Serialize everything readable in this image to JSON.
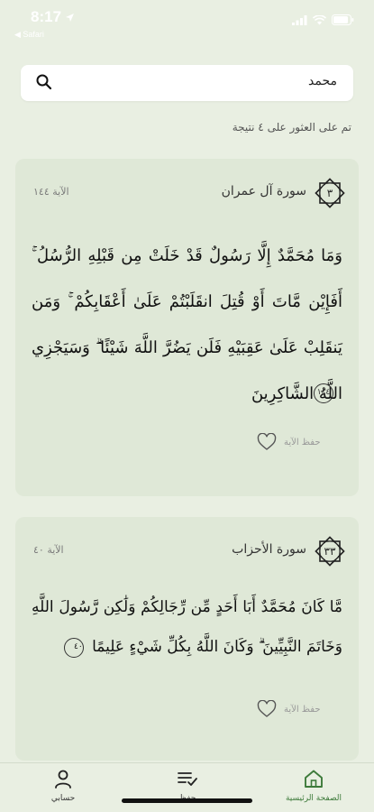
{
  "status_bar": {
    "time": "8:17",
    "back_app": "◀ Safari"
  },
  "search": {
    "value": "محمد"
  },
  "results": {
    "count_text": "تم على العثور على ٤ نتيجة"
  },
  "cards": [
    {
      "surah_number": "٣",
      "surah_name": "سورة آل عمران",
      "ayah_label": "الآية ١٤٤",
      "verse_text": "وَمَا مُحَمَّدٌ إِلَّا رَسُولٌ قَدْ خَلَتْ مِن قَبْلِهِ الرُّسُلُ ۚ أَفَإِيْن مَّاتَ أَوْ قُتِلَ انقَلَبْتُمْ عَلَىٰ أَعْقَابِكُمْ ۚ وَمَن يَنقَلِبْ عَلَىٰ عَقِبَيْهِ فَلَن يَضُرَّ اللَّهَ شَيْئًا ۗ وَسَيَجْزِي اللَّهُ الشَّاكِرِينَ",
      "ayah_marker": "١٤٤",
      "save_label": "حفظ الآية"
    },
    {
      "surah_number": "٣٣",
      "surah_name": "سورة الأحزاب",
      "ayah_label": "الآية ٤٠",
      "verse_text": "مَّا كَانَ مُحَمَّدٌ أَبَا أَحَدٍ مِّن رِّجَالِكُمْ وَلَٰكِن رَّسُولَ اللَّهِ وَخَاتَمَ النَّبِيِّينَ ۗ وَكَانَ اللَّهُ بِكُلِّ شَيْءٍ عَلِيمًا",
      "ayah_marker": "٤٠",
      "save_label": "حفظ الآية"
    }
  ],
  "tabs": {
    "account": "حسابي",
    "memorize": "حفظ",
    "home": "الصفحة الرئيسية"
  },
  "colors": {
    "accent": "#3d7a3a",
    "background": "#e9efe2",
    "card": "#dfe8d7"
  },
  "icons": [
    "search-icon",
    "heart-icon",
    "user-icon",
    "list-check-icon",
    "home-icon",
    "location-arrow-icon",
    "signal-icon",
    "wifi-icon",
    "battery-icon"
  ]
}
